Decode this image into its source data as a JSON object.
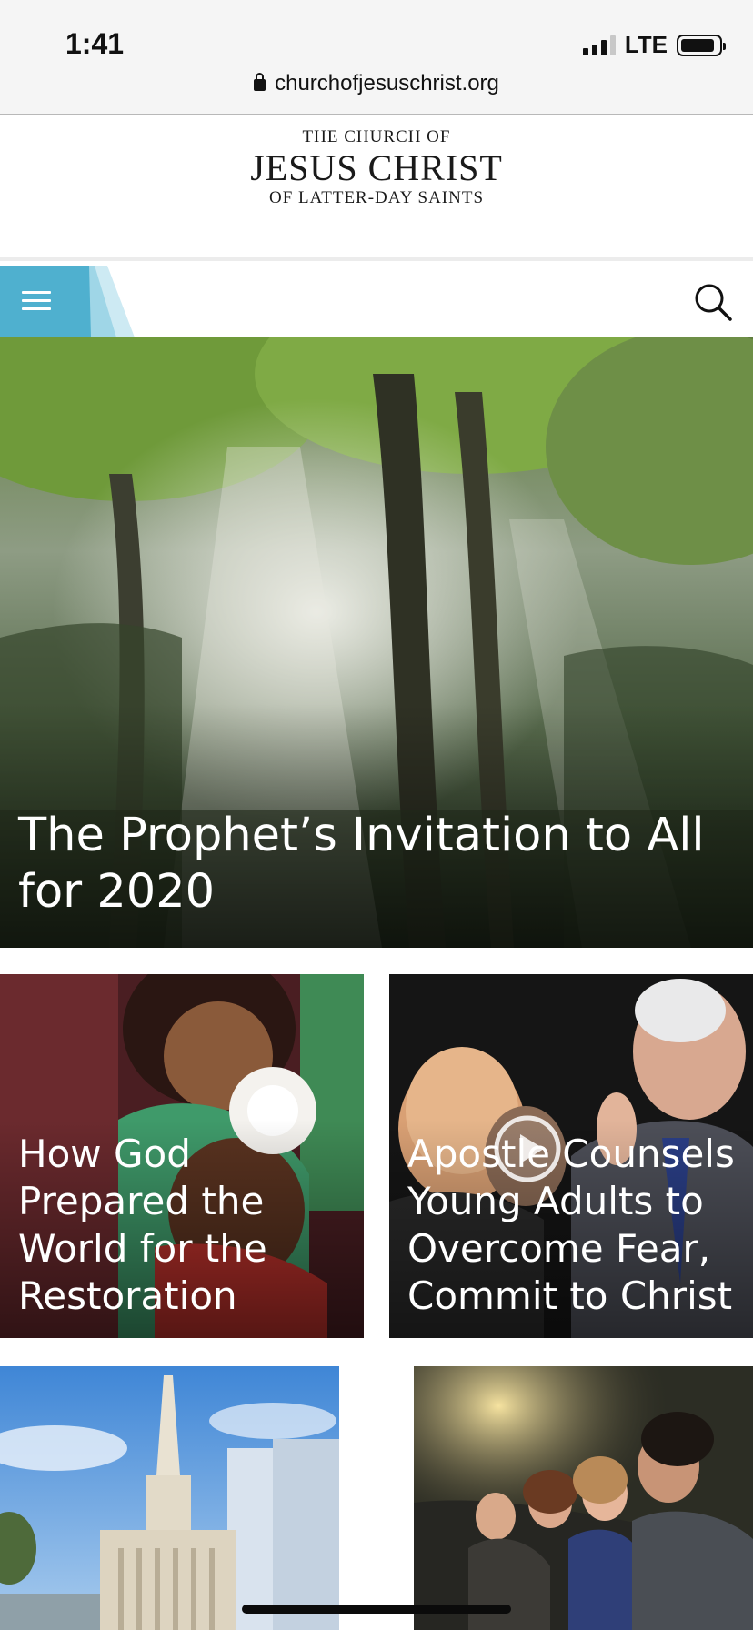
{
  "status_bar": {
    "time": "1:41",
    "network": "LTE"
  },
  "browser": {
    "url": "churchofjesuschrist.org"
  },
  "logo": {
    "line1": "THE CHURCH OF",
    "line2": "JESUS CHRIST",
    "line3": "OF LATTER-DAY SAINTS"
  },
  "nav": {
    "menu_icon": "hamburger-menu-icon",
    "search_icon": "search-icon",
    "accent_color": "#4fb0cf"
  },
  "hero": {
    "title": "The Prophet’s Invitation to All for 2020"
  },
  "cards": [
    {
      "title": "How God Prepared the World for the Restoration"
    },
    {
      "title": "Apostle Counsels Young Adults to Overcome Fear, Commit to Christ",
      "icon": "play-icon"
    }
  ]
}
